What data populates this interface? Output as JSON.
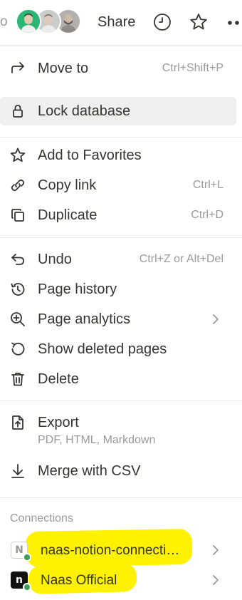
{
  "topbar": {
    "cut_text": "o",
    "share_label": "Share"
  },
  "menu": {
    "group1": [
      {
        "label": "Move to",
        "shortcut": "Ctrl+Shift+P",
        "icon": "arrow-turn-right-icon"
      },
      {
        "label": "Lock database",
        "shortcut": "",
        "icon": "lock-icon"
      }
    ],
    "group2": [
      {
        "label": "Add to Favorites",
        "shortcut": "",
        "icon": "star-icon"
      },
      {
        "label": "Copy link",
        "shortcut": "Ctrl+L",
        "icon": "link-icon"
      },
      {
        "label": "Duplicate",
        "shortcut": "Ctrl+D",
        "icon": "duplicate-icon"
      }
    ],
    "group3": [
      {
        "label": "Undo",
        "shortcut": "Ctrl+Z or Alt+Del",
        "icon": "undo-icon"
      },
      {
        "label": "Page history",
        "shortcut": "",
        "icon": "history-icon"
      },
      {
        "label": "Page analytics",
        "shortcut": "",
        "icon": "analytics-icon"
      },
      {
        "label": "Show deleted pages",
        "shortcut": "",
        "icon": "restore-icon"
      },
      {
        "label": "Delete",
        "shortcut": "",
        "icon": "trash-icon"
      }
    ],
    "group4": [
      {
        "label": "Export",
        "sublabel": "PDF, HTML, Markdown",
        "icon": "export-icon"
      },
      {
        "label": "Merge with CSV",
        "icon": "download-arrow-icon"
      }
    ],
    "connections": {
      "heading": "Connections",
      "items": [
        {
          "label": "naas-notion-connecti…",
          "logo": "N",
          "icon": "integration-icon"
        },
        {
          "label": "Naas Official",
          "logo": "n",
          "icon": "naas-logo-icon"
        }
      ]
    }
  },
  "colors": {
    "text": "#37352f",
    "muted": "#9b9a97",
    "hover_bg": "#efefed",
    "divider": "#e9e9e7",
    "highlight": "#fff200",
    "status_dot": "#3e9b5a"
  }
}
